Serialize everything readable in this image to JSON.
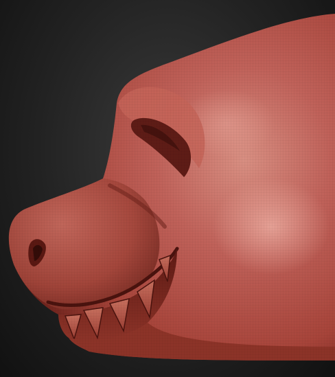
{
  "scene": {
    "subject": "sculpted-creature-head",
    "material_color": "#b24a3a",
    "highlight_color": "#d98a7c",
    "shadow_color": "#5a1c16",
    "background_color": "#2a2a2a",
    "wireframe": true
  }
}
